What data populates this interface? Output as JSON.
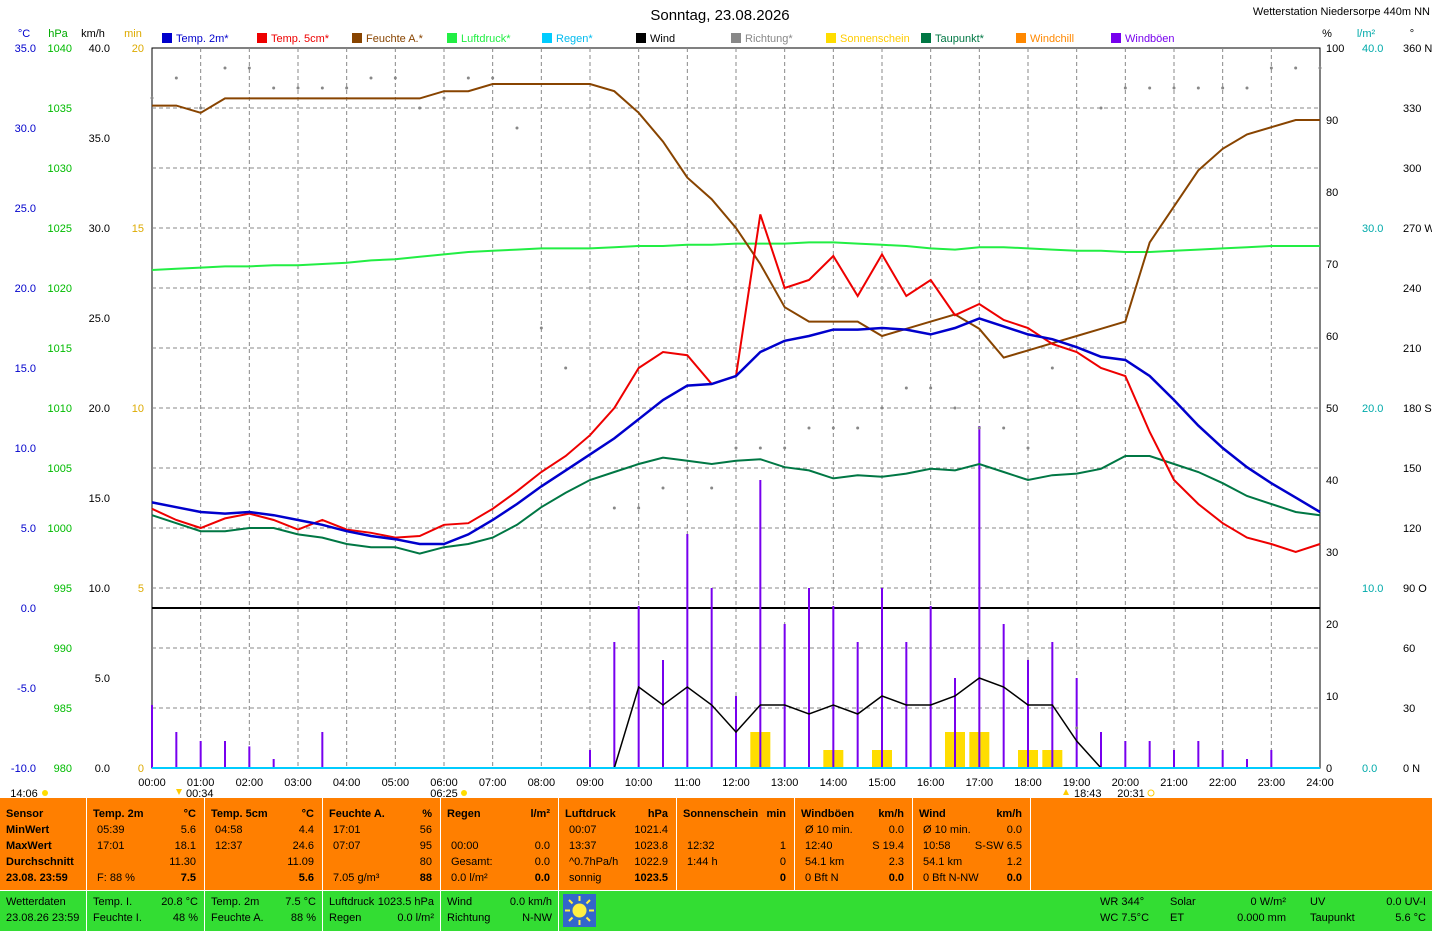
{
  "header": {
    "title": "Sonntag, 23.08.2026",
    "station": "Wetterstation Niedersorpe 440m NN"
  },
  "legend": [
    {
      "label": "Temp. 2m*",
      "color": "#0000cc"
    },
    {
      "label": "Temp. 5cm*",
      "color": "#ee0000"
    },
    {
      "label": "Feuchte A.*",
      "color": "#884400"
    },
    {
      "label": "Luftdruck*",
      "color": "#22ee44"
    },
    {
      "label": "Regen*",
      "color": "#00ccff"
    },
    {
      "label": "Wind",
      "color": "#000000"
    },
    {
      "label": "Richtung*",
      "color": "#888888"
    },
    {
      "label": "Sonnenschein",
      "color": "#ffdd00"
    },
    {
      "label": "Taupunkt*",
      "color": "#007744"
    },
    {
      "label": "Windchill",
      "color": "#ff8800"
    },
    {
      "label": "Windböen",
      "color": "#7700ee"
    }
  ],
  "axis_units": {
    "temp": "°C",
    "pressure": "hPa",
    "wind": "km/h",
    "sun": "min",
    "humidity": "%",
    "rain": "l/m²",
    "direction": "°"
  },
  "axis_ticks": {
    "temp": [
      "35.0",
      "30.0",
      "25.0",
      "20.0",
      "15.0",
      "10.0",
      "5.0",
      "0.0",
      "-5.0",
      "-10.0"
    ],
    "pressure": [
      "1040",
      "1035",
      "1030",
      "1025",
      "1020",
      "1015",
      "1010",
      "1005",
      "1000",
      "995",
      "990",
      "985",
      "980"
    ],
    "wind": [
      "40.0",
      "35.0",
      "30.0",
      "25.0",
      "20.0",
      "15.0",
      "10.0",
      "5.0",
      "0.0"
    ],
    "sun": [
      "20",
      "15",
      "10",
      "5",
      "0"
    ],
    "humidity": [
      "100",
      "90",
      "80",
      "70",
      "60",
      "50",
      "40",
      "30",
      "20",
      "10",
      "0"
    ],
    "rain": [
      "40.0",
      "30.0",
      "20.0",
      "10.0",
      "0.0"
    ],
    "direction": [
      "360 N",
      "330",
      "300",
      "270 W",
      "240",
      "210",
      "180 S",
      "150",
      "120",
      "90 O",
      "60",
      "30",
      "0 N"
    ],
    "time": [
      "00:00",
      "01:00",
      "02:00",
      "03:00",
      "04:00",
      "05:00",
      "06:00",
      "07:00",
      "08:00",
      "09:00",
      "10:00",
      "11:00",
      "12:00",
      "13:00",
      "14:00",
      "15:00",
      "16:00",
      "17:00",
      "18:00",
      "19:00",
      "20:00",
      "21:00",
      "22:00",
      "23:00",
      "24:00"
    ]
  },
  "astro_marks": {
    "moonset": "14:06",
    "moonrise_start": "00:34",
    "sunrise": "06:25",
    "sunset": "18:43",
    "dusk": "20:31"
  },
  "chart_data": {
    "type": "line",
    "x_unit": "hour of day",
    "x": [
      0,
      0.5,
      1,
      1.5,
      2,
      2.5,
      3,
      3.5,
      4,
      4.5,
      5,
      5.5,
      6,
      6.5,
      7,
      7.5,
      8,
      8.5,
      9,
      9.5,
      10,
      10.5,
      11,
      11.5,
      12,
      12.5,
      13,
      13.5,
      14,
      14.5,
      15,
      15.5,
      16,
      16.5,
      17,
      17.5,
      18,
      18.5,
      19,
      19.5,
      20,
      20.5,
      21,
      21.5,
      22,
      22.5,
      23,
      23.5,
      24
    ],
    "series": [
      {
        "name": "Temp. 2m*",
        "unit": "°C",
        "values": [
          6.6,
          6.3,
          6.0,
          5.9,
          6.0,
          5.8,
          5.5,
          5.2,
          4.8,
          4.5,
          4.3,
          4.0,
          4.0,
          4.6,
          5.5,
          6.5,
          7.6,
          8.6,
          9.6,
          10.6,
          11.8,
          13.0,
          13.9,
          14.0,
          14.5,
          16.0,
          16.7,
          17.0,
          17.4,
          17.4,
          17.5,
          17.4,
          17.1,
          17.5,
          18.1,
          17.6,
          17.1,
          16.8,
          16.3,
          15.7,
          15.5,
          14.5,
          13.0,
          11.4,
          10.0,
          8.8,
          7.8,
          6.9,
          6.0
        ]
      },
      {
        "name": "Temp. 5cm*",
        "unit": "°C",
        "values": [
          6.2,
          5.5,
          5.0,
          5.6,
          5.9,
          5.5,
          4.9,
          5.5,
          4.9,
          4.7,
          4.4,
          4.5,
          5.2,
          5.3,
          6.2,
          7.3,
          8.5,
          9.5,
          10.8,
          12.5,
          15.0,
          16.0,
          15.8,
          14.0,
          14.5,
          24.6,
          20.0,
          20.5,
          22.0,
          19.5,
          22.1,
          19.5,
          20.5,
          18.3,
          19.0,
          18.0,
          17.5,
          16.5,
          16.0,
          15.0,
          14.5,
          11.0,
          8.0,
          6.5,
          5.3,
          4.4,
          4.0,
          3.5,
          4.0
        ]
      },
      {
        "name": "Feuchte A.*",
        "unit": "%",
        "values": [
          92,
          92,
          91,
          93,
          93,
          93,
          93,
          93,
          93,
          93,
          93,
          93,
          94,
          94,
          95,
          95,
          95,
          95,
          95,
          94,
          91,
          87,
          82,
          79,
          75,
          70,
          64,
          62,
          62,
          62,
          60,
          61,
          62,
          63,
          61,
          57,
          58,
          59,
          60,
          61,
          62,
          73,
          78,
          83,
          86,
          88,
          89,
          90,
          90
        ]
      },
      {
        "name": "Luftdruck*",
        "unit": "hPa",
        "values": [
          1021.5,
          1021.6,
          1021.7,
          1021.8,
          1021.8,
          1021.9,
          1021.9,
          1022.0,
          1022.1,
          1022.3,
          1022.4,
          1022.6,
          1022.8,
          1023.0,
          1023.1,
          1023.2,
          1023.3,
          1023.3,
          1023.3,
          1023.4,
          1023.5,
          1023.5,
          1023.6,
          1023.6,
          1023.7,
          1023.7,
          1023.7,
          1023.8,
          1023.8,
          1023.7,
          1023.6,
          1023.5,
          1023.3,
          1023.2,
          1023.4,
          1023.4,
          1023.3,
          1023.2,
          1023.1,
          1023.1,
          1023.0,
          1023.0,
          1023.1,
          1023.2,
          1023.3,
          1023.4,
          1023.5,
          1023.5,
          1023.5
        ]
      },
      {
        "name": "Taupunkt*",
        "unit": "°C",
        "values": [
          5.8,
          5.3,
          4.8,
          4.8,
          5.0,
          5.0,
          4.6,
          4.4,
          4.0,
          3.8,
          3.8,
          3.4,
          3.8,
          4.0,
          4.4,
          5.2,
          6.3,
          7.2,
          8.0,
          8.5,
          9.0,
          9.4,
          9.2,
          9.0,
          9.2,
          9.3,
          8.8,
          8.6,
          8.1,
          8.3,
          8.2,
          8.4,
          8.7,
          8.6,
          9.0,
          8.5,
          8.0,
          8.3,
          8.4,
          8.7,
          9.5,
          9.5,
          9.0,
          8.5,
          7.8,
          7.0,
          6.5,
          6.0,
          5.8
        ]
      },
      {
        "name": "Wind",
        "unit": "km/h",
        "values": [
          0,
          0,
          0,
          0,
          0,
          0,
          0,
          0,
          0,
          0,
          0,
          0,
          0,
          0,
          0,
          0,
          0,
          0,
          0,
          0,
          4.5,
          3.5,
          4.5,
          3.5,
          2,
          3.5,
          3.5,
          3,
          3.5,
          3,
          4,
          3.5,
          3.5,
          4,
          5,
          4.5,
          3.5,
          3.5,
          1.5,
          0,
          0,
          0,
          0,
          0,
          0,
          0,
          0,
          0,
          0
        ]
      },
      {
        "name": "Windböen",
        "unit": "km/h",
        "values": [
          3.5,
          2,
          1.5,
          1.5,
          1.2,
          0.5,
          0,
          2,
          0,
          0,
          0,
          0,
          0,
          0,
          0,
          0,
          0,
          0,
          1,
          7,
          9,
          6,
          13,
          10,
          4,
          16,
          8,
          10,
          9,
          7,
          10,
          7,
          9,
          5,
          19,
          8,
          6,
          7,
          5,
          2,
          1.5,
          1.5,
          1,
          1.5,
          1,
          0.5,
          1,
          0,
          0
        ]
      },
      {
        "name": "Sonnenschein",
        "unit": "min",
        "values": [
          0,
          0,
          0,
          0,
          0,
          0,
          0,
          0,
          0,
          0,
          0,
          0,
          0,
          0,
          0,
          0,
          0,
          0,
          0,
          0,
          0,
          0,
          0,
          0,
          0,
          1,
          0,
          0,
          0.5,
          0,
          0.5,
          0,
          0,
          1,
          1,
          0,
          0.5,
          0.5,
          0,
          0,
          0,
          0,
          0,
          0,
          0,
          0,
          0,
          0,
          0
        ]
      },
      {
        "name": "Richtung*",
        "unit": "°",
        "values": [
          335,
          345,
          330,
          350,
          350,
          340,
          340,
          340,
          340,
          345,
          345,
          330,
          335,
          345,
          345,
          320,
          220,
          200,
          160,
          130,
          130,
          140,
          150,
          140,
          160,
          160,
          160,
          170,
          170,
          170,
          180,
          190,
          190,
          180,
          170,
          170,
          160,
          200,
          20,
          330,
          340,
          340,
          340,
          340,
          340,
          340,
          350,
          350,
          350
        ]
      },
      {
        "name": "Regen*",
        "unit": "l/m²",
        "values": [
          0,
          0,
          0,
          0,
          0,
          0,
          0,
          0,
          0,
          0,
          0,
          0,
          0,
          0,
          0,
          0,
          0,
          0,
          0,
          0,
          0,
          0,
          0,
          0,
          0,
          0,
          0,
          0,
          0,
          0,
          0,
          0,
          0,
          0,
          0,
          0,
          0,
          0,
          0,
          0,
          0,
          0,
          0,
          0,
          0,
          0,
          0,
          0,
          0
        ]
      }
    ],
    "axes": {
      "temp_range": [
        -10,
        35
      ],
      "pressure_range": [
        980,
        1040
      ],
      "wind_range": [
        0,
        40
      ],
      "sun_range": [
        0,
        20
      ],
      "humidity_range": [
        0,
        100
      ],
      "rain_range": [
        0,
        40
      ],
      "direction_range": [
        0,
        360
      ]
    },
    "grid": true
  },
  "panel": {
    "sensor": {
      "title": "Sensor",
      "rows": [
        "MinWert",
        "MaxWert",
        "Durchschnitt",
        "23.08. 23:59"
      ]
    },
    "temp2m": {
      "title": "Temp. 2m",
      "unit": "°C",
      "rows": [
        [
          "05:39",
          "5.6"
        ],
        [
          "17:01",
          "18.1"
        ],
        [
          "",
          "11.30"
        ],
        [
          "F: 88 %",
          "7.5"
        ]
      ]
    },
    "temp5cm": {
      "title": "Temp. 5cm",
      "unit": "°C",
      "rows": [
        [
          "04:58",
          "4.4"
        ],
        [
          "12:37",
          "24.6"
        ],
        [
          "",
          "11.09"
        ],
        [
          "",
          "5.6"
        ]
      ]
    },
    "humidity": {
      "title": "Feuchte A.",
      "unit": "%",
      "rows": [
        [
          "17:01",
          "56"
        ],
        [
          "07:07",
          "95"
        ],
        [
          "",
          "80"
        ],
        [
          "7.05 g/m³",
          "88"
        ]
      ]
    },
    "rain": {
      "title": "Regen",
      "unit": "l/m²",
      "rows": [
        [
          "",
          ""
        ],
        [
          "00:00",
          "0.0"
        ],
        [
          "Gesamt:",
          "0.0"
        ],
        [
          "0.0 l/m²",
          "0.0"
        ]
      ]
    },
    "pressure": {
      "title": "Luftdruck",
      "unit": "hPa",
      "rows": [
        [
          "00:07",
          "1021.4"
        ],
        [
          "13:37",
          "1023.8"
        ],
        [
          "^0.7hPa/h",
          "1022.9"
        ],
        [
          "sonnig",
          "1023.5"
        ]
      ]
    },
    "sunshine": {
      "title": "Sonnenschein",
      "unit": "min",
      "rows": [
        [
          "",
          ""
        ],
        [
          "12:32",
          "1"
        ],
        [
          "1:44 h",
          "0"
        ],
        [
          "",
          "0"
        ]
      ]
    },
    "gusts": {
      "title": "Windböen",
      "unit": "km/h",
      "rows": [
        [
          "Ø 10 min.",
          "0.0"
        ],
        [
          "12:40",
          "S 19.4"
        ],
        [
          "54.1 km",
          "2.3"
        ],
        [
          "0 Bft N",
          "0.0"
        ]
      ]
    },
    "wind": {
      "title": "Wind",
      "unit": "km/h",
      "rows": [
        [
          "Ø 10 min.",
          "0.0"
        ],
        [
          "10:58",
          "S-SW 6.5"
        ],
        [
          "54.1 km",
          "1.2"
        ],
        [
          "0 Bft N-NW",
          "0.0"
        ]
      ]
    }
  },
  "status": {
    "wd_label": "Wetterdaten",
    "wd_time": "23.08.26 23:59",
    "temp_i_label": "Temp. I.",
    "temp_i": "20.8 °C",
    "feuchte_i_label": "Feuchte I.",
    "feuchte_i": "48 %",
    "temp2m_label": "Temp. 2m",
    "temp2m": "7.5 °C",
    "feuchte_a_label": "Feuchte A.",
    "feuchte_a": "88 %",
    "luftdruck_label": "Luftdruck",
    "luftdruck": "1023.5 hPa",
    "regen_label": "Regen",
    "regen": "0.0 l/m²",
    "wind_label": "Wind",
    "wind": "0.0 km/h",
    "richtung_label": "Richtung",
    "richtung": "N-NW",
    "wr": "WR 344°",
    "wc": "WC 7.5°C",
    "solar_label": "Solar",
    "solar": "0 W/m²",
    "et_label": "ET",
    "et": "0.000 mm",
    "uv_label": "UV",
    "uv": "0.0 UV-I",
    "taupunkt_label": "Taupunkt",
    "taupunkt": "5.6 °C"
  }
}
